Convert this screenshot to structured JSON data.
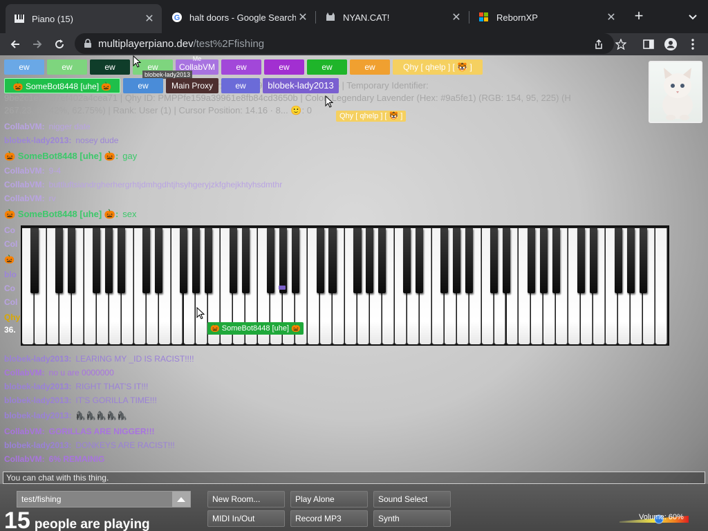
{
  "browser": {
    "tabs": [
      {
        "title": "Piano (15)",
        "active": true
      },
      {
        "title": "halt doors - Google Search",
        "active": false
      },
      {
        "title": "NYAN.CAT!",
        "active": false
      },
      {
        "title": "RebornXP",
        "active": false
      }
    ],
    "url_host": "multiplayerpiano.dev",
    "url_path": "/test%2Ffishing"
  },
  "player_tags_row1": [
    {
      "label": "ew",
      "color": "#6aa8e6"
    },
    {
      "label": "ew",
      "color": "#7ed57e"
    },
    {
      "label": "ew",
      "color": "#0f3d2a"
    },
    {
      "label": "ew",
      "color": "#7ed57e"
    },
    {
      "label": "CollabVM",
      "color": "#a873e0",
      "sub": "Me"
    },
    {
      "label": "ew",
      "color": "#a247d9"
    },
    {
      "label": "ew",
      "color": "#a22fd1"
    },
    {
      "label": "ew",
      "color": "#1fb52a"
    },
    {
      "label": "ew",
      "color": "#f0a030"
    },
    {
      "label": "Qhy [ qhelp ] [ 🐯 ]",
      "color": "#f5d060"
    }
  ],
  "player_tags_row2": [
    {
      "label": "🎃 SomeBot8448 [uhe] 🎃",
      "color": "#1fbf4a"
    },
    {
      "label": "ew",
      "color": "#4a8cd8"
    },
    {
      "label": "Main Proxy",
      "color": "#4d2f2f"
    },
    {
      "label": "ew",
      "color": "#6b6bd8"
    },
    {
      "label": "blobek-lady2013",
      "color": "#7a5fd0"
    }
  ],
  "annotations": {
    "blobek_tag_above": "blobek-lady2013",
    "qhy_cursor_tag": "Qhy [ qhelp ] [ 🐯 ]"
  },
  "info_lines": [
    "fier: fe159a39961e8fb84cd3650b | Temporary Identifier:",
    "9be2c1e27cf7ef402a4cea71 | Qhy ID: PMPPfe159a39961e8fb84cd3650b | Color: Legendary Lavender (Hex: #9a5fe1) (RGB: 154, 95, 225) (H",
    "267.23, 68.42%, 62.75%) | Rank: User (1) | Cursor Position: 14.16 · 8... 🙂: 0"
  ],
  "chat_above": [
    {
      "user": "CollabVM:",
      "msg": "nigger date",
      "ucolor": "#b9a3e3",
      "mcolor": "#b9a3e3"
    },
    {
      "user": "blobek-lady2013:",
      "msg": "nosey dude",
      "ucolor": "#9c85d8",
      "mcolor": "#9c85d8"
    },
    {
      "user": "🎃 SomeBot8448 [uhe] 🎃:",
      "msg": "gay",
      "ucolor": "#3cc86a",
      "mcolor": "#3cc86a"
    },
    {
      "user": "CollabVM:",
      "msg": "9-4",
      "ucolor": "#b9a3e3",
      "mcolor": "#b9a3e3"
    },
    {
      "user": "CollabVM:",
      "msg": "buttluftsiandrgherhergrhtjdmhgdhtjhsyhgeryjzkfghejkhtyhsdmthr",
      "ucolor": "#b9a3e3",
      "mcolor": "#b9a3e3"
    },
    {
      "user": "CollabVM:",
      "msg": "rv",
      "ucolor": "#b9a3e3",
      "mcolor": "#b9a3e3"
    },
    {
      "user": "🎃 SomeBot8448 [uhe] 🎃:",
      "msg": "sex",
      "ucolor": "#3cc86a",
      "mcolor": "#3cc86a"
    }
  ],
  "chat_left_fragments": [
    "Co",
    "Col",
    "🎃",
    "blo",
    "Co",
    "Col",
    "Qhy",
    "36."
  ],
  "chat_below": [
    {
      "user": "blobek-lady2013:",
      "msg": "LEARING MY _ID IS RACIST!!!!",
      "ucolor": "#9a80d8",
      "mcolor": "#9a80d8"
    },
    {
      "user": "CollabVM:",
      "msg": "no u are 0000000",
      "ucolor": "#a873e0",
      "mcolor": "#a873e0"
    },
    {
      "user": "blobek-lady2013:",
      "msg": "RIGHT THAT'S IT!!!",
      "ucolor": "#9a80d8",
      "mcolor": "#9a80d8"
    },
    {
      "user": "blobek-lady2013:",
      "msg": "IT'S GORILLA TIME!!!",
      "ucolor": "#9a80d8",
      "mcolor": "#9a80d8"
    },
    {
      "user": "blobek-lady2013:",
      "msg": "🦍🦍🦍🦍🦍",
      "ucolor": "#9a80d8",
      "mcolor": "#9a80d8"
    },
    {
      "user": "CollabVM:",
      "msg": "GORILLAS ARE NIGGER!!!",
      "ucolor": "#a873e0",
      "mcolor": "#a873e0"
    },
    {
      "user": "blobek-lady2013:",
      "msg": "DONKEYS ARE RACIST!!!",
      "ucolor": "#9a80d8",
      "mcolor": "#9a80d8"
    },
    {
      "user": "CollabVM:",
      "msg": "6% REMAINIG",
      "ucolor": "#a873e0",
      "mcolor": "#a873e0"
    }
  ],
  "piano_tag": "🎃 SomeBot8448 [uhe] 🎃",
  "chat_input_placeholder": "You can chat with this thing.",
  "room_name": "test/fishing",
  "people_count": "15",
  "people_text": "people are playing",
  "buttons": {
    "new_room": "New Room...",
    "play_alone": "Play Alone",
    "sound_select": "Sound Select",
    "midi": "MIDI In/Out",
    "record": "Record MP3",
    "synth": "Synth"
  },
  "volume_label": "Volume: 60%",
  "volume": 0.6
}
